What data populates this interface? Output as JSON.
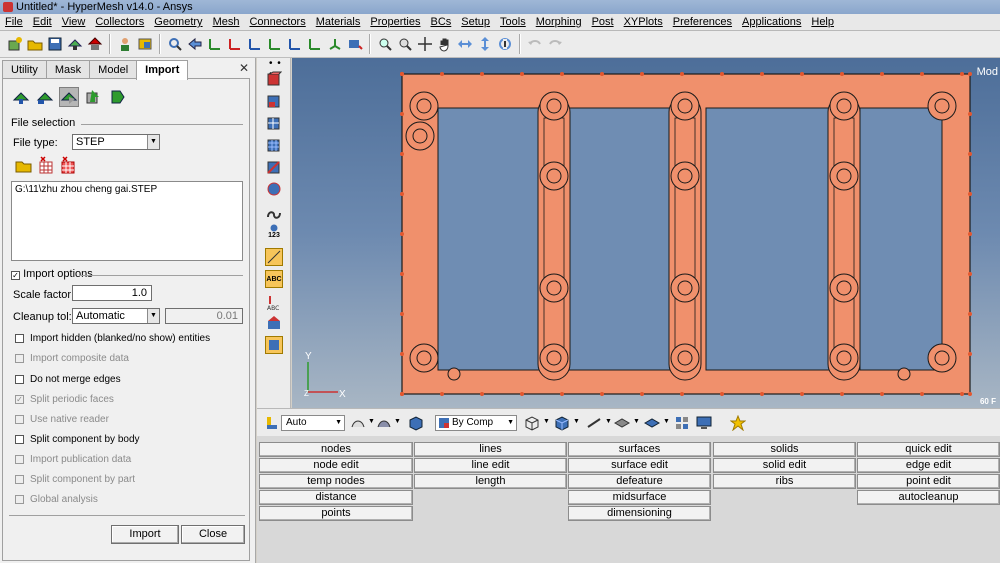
{
  "window": {
    "title": "Untitled* - HyperMesh v14.0 - Ansys"
  },
  "menu": [
    "File",
    "Edit",
    "View",
    "Collectors",
    "Geometry",
    "Mesh",
    "Connectors",
    "Materials",
    "Properties",
    "BCs",
    "Setup",
    "Tools",
    "Morphing",
    "Post",
    "XYPlots",
    "Preferences",
    "Applications",
    "Help"
  ],
  "left_panel": {
    "tabs": [
      "Utility",
      "Mask",
      "Model",
      "Import"
    ],
    "active_tab": "Import",
    "close_glyph": "✕",
    "file_selection_label": "File selection",
    "file_type_label": "File type:",
    "file_type_value": "STEP",
    "file_path": "G:\\11\\zhu zhou cheng gai.STEP",
    "import_options_label": "Import options",
    "scale_factor_label": "Scale factor:",
    "scale_factor_value": "1.0",
    "cleanup_tol_label": "Cleanup tol:",
    "cleanup_tol_value": "Automatic",
    "cleanup_tol_number": "0.01",
    "options": [
      {
        "label": "Import hidden (blanked/no show) entities",
        "checked": false,
        "disabled": false
      },
      {
        "label": "Import composite data",
        "checked": false,
        "disabled": true
      },
      {
        "label": "Do not merge edges",
        "checked": false,
        "disabled": false
      },
      {
        "label": "Split periodic faces",
        "checked": true,
        "disabled": true
      },
      {
        "label": "Use native reader",
        "checked": false,
        "disabled": true
      },
      {
        "label": "Split component by body",
        "checked": false,
        "disabled": false
      },
      {
        "label": "Import publication data",
        "checked": false,
        "disabled": true
      },
      {
        "label": "Split component by part",
        "checked": false,
        "disabled": true
      },
      {
        "label": "Global analysis",
        "checked": false,
        "disabled": true
      }
    ],
    "import_button": "Import",
    "close_button": "Close"
  },
  "viewport": {
    "model_label": "Mod",
    "scale_label": "60 F",
    "axis_y": "Y",
    "axis_x": "X",
    "axis_z": "Z",
    "part_color": "#f0906c",
    "edge_color": "#1a1a1a",
    "background_top": "#4d6e99",
    "background_bottom": "#a8b6c4"
  },
  "bottom_toolbar": {
    "auto_select": "Auto",
    "comp_select": "By Comp"
  },
  "panel_buttons": {
    "col1": [
      "nodes",
      "node edit",
      "temp nodes",
      "distance",
      "points"
    ],
    "col2": [
      "lines",
      "line edit",
      "length"
    ],
    "col3": [
      "surfaces",
      "surface edit",
      "defeature",
      "midsurface",
      "dimensioning"
    ],
    "col4": [
      "solids",
      "solid edit",
      "ribs"
    ],
    "col5": [
      "quick edit",
      "edge edit",
      "point edit",
      "autocleanup"
    ]
  },
  "vertical_toolbar": {
    "label_123": "123",
    "label_abc": "ABC"
  }
}
